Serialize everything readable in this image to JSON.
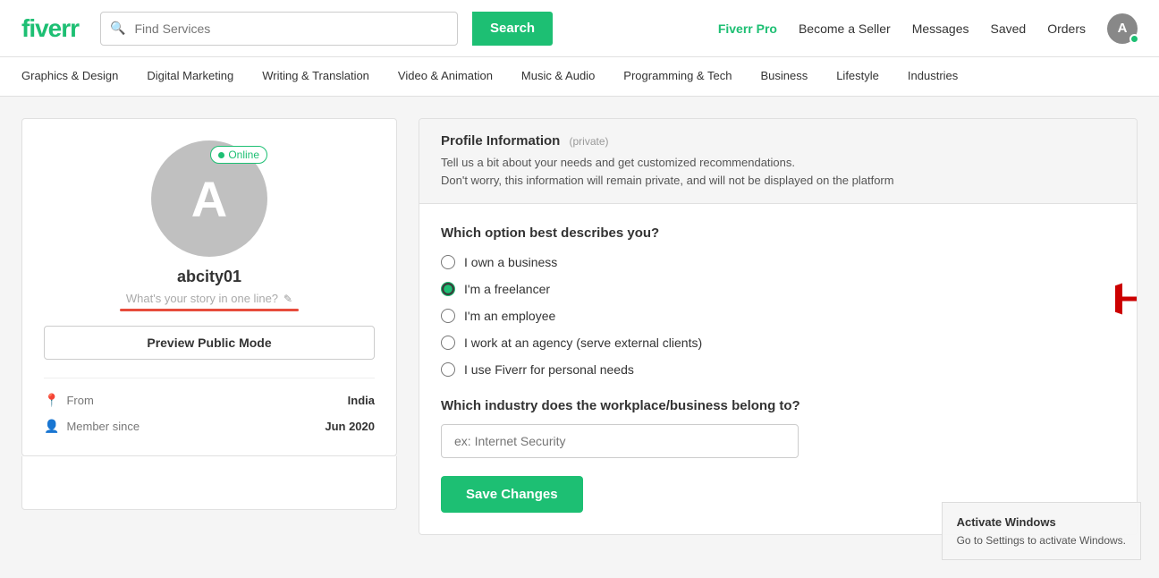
{
  "header": {
    "logo": "fiverr",
    "search_placeholder": "Find Services",
    "search_btn": "Search",
    "nav_pro": "Fiverr Pro",
    "nav_seller": "Become a Seller",
    "nav_messages": "Messages",
    "nav_saved": "Saved",
    "nav_orders": "Orders",
    "avatar_letter": "A"
  },
  "categories": [
    "Graphics & Design",
    "Digital Marketing",
    "Writing & Translation",
    "Video & Animation",
    "Music & Audio",
    "Programming & Tech",
    "Business",
    "Lifestyle",
    "Industries"
  ],
  "profile": {
    "avatar_letter": "A",
    "online_status": "Online",
    "username": "abcity01",
    "tagline_placeholder": "What's your story in one line?",
    "preview_btn": "Preview Public Mode",
    "from_label": "From",
    "from_value": "India",
    "member_label": "Member since",
    "member_value": "Jun 2020"
  },
  "profile_info": {
    "title": "Profile Information",
    "private_label": "(private)",
    "desc_line1": "Tell us a bit about your needs and get customized recommendations.",
    "desc_line2": "Don't worry, this information will remain private, and will not be displayed on the platform"
  },
  "form": {
    "question1": "Which option best describes you?",
    "options": [
      {
        "id": "opt1",
        "label": "I own a business",
        "checked": false
      },
      {
        "id": "opt2",
        "label": "I'm a freelancer",
        "checked": true
      },
      {
        "id": "opt3",
        "label": "I'm an employee",
        "checked": false
      },
      {
        "id": "opt4",
        "label": "I work at an agency (serve external clients)",
        "checked": false
      },
      {
        "id": "opt5",
        "label": "I use Fiverr for personal needs",
        "checked": false
      }
    ],
    "question2": "Which industry does the workplace/business belong to?",
    "industry_placeholder": "ex: Internet Security",
    "save_btn": "Save Changes"
  },
  "windows": {
    "title": "Activate Windows",
    "desc": "Go to Settings to activate Windows."
  }
}
